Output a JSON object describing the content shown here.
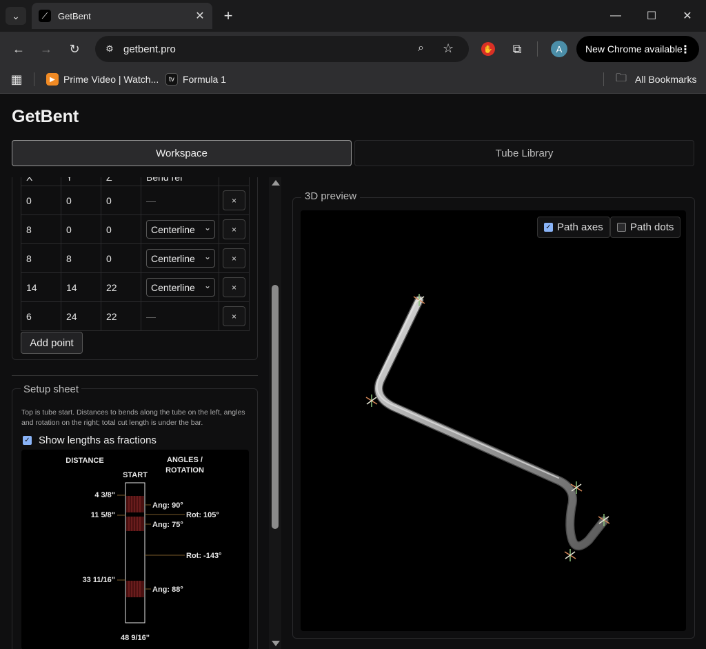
{
  "browser": {
    "tab_title": "GetBent",
    "url": "getbent.pro",
    "update_label": "New Chrome available",
    "avatar_letter": "A",
    "bookmarks": [
      {
        "label": "Prime Video | Watch..."
      },
      {
        "label": "Formula 1"
      }
    ],
    "all_bookmarks_label": "All Bookmarks"
  },
  "app": {
    "title": "GetBent",
    "tabs": [
      {
        "label": "Workspace",
        "active": true
      },
      {
        "label": "Tube Library",
        "active": false
      }
    ]
  },
  "points": {
    "headers": [
      "X",
      "Y",
      "Z",
      "Bend ref"
    ],
    "rows": [
      {
        "x": "0",
        "y": "0",
        "z": "0",
        "bend_ref": "—",
        "delete": "×"
      },
      {
        "x": "8",
        "y": "0",
        "z": "0",
        "bend_ref": "Centerline",
        "delete": "×"
      },
      {
        "x": "8",
        "y": "8",
        "z": "0",
        "bend_ref": "Centerline",
        "delete": "×"
      },
      {
        "x": "14",
        "y": "14",
        "z": "22",
        "bend_ref": "Centerline",
        "delete": "×"
      },
      {
        "x": "6",
        "y": "24",
        "z": "22",
        "bend_ref": "—",
        "delete": "×"
      }
    ],
    "add_point_label": "Add point"
  },
  "setup_sheet": {
    "legend": "Setup sheet",
    "description": "Top is tube start. Distances to bends along the tube on the left, angles and rotation on the right; total cut length is under the bar.",
    "fractions_label": "Show lengths as fractions",
    "fractions_checked": true,
    "distance_header": "DISTANCE",
    "angles_header_1": "ANGLES /",
    "angles_header_2": "ROTATION",
    "start_label": "START",
    "bends": [
      {
        "distance": "4 3/8\"",
        "angle": "Ang: 90°",
        "rotation": "Rot: 105°"
      },
      {
        "distance": "11 5/8\"",
        "angle": "Ang: 75°",
        "rotation": "Rot: -143°"
      },
      {
        "distance": "33 11/16\"",
        "angle": "Ang: 88°",
        "rotation": ""
      }
    ],
    "total_length": "48 9/16\""
  },
  "preview": {
    "legend": "3D preview",
    "path_axes_label": "Path axes",
    "path_axes_checked": true,
    "path_dots_label": "Path dots",
    "path_dots_checked": false
  },
  "colors": {
    "accent_checkbox": "#8ab4f8",
    "bend_zone": "#7a1a1a",
    "tube": "#a8a8a8"
  }
}
